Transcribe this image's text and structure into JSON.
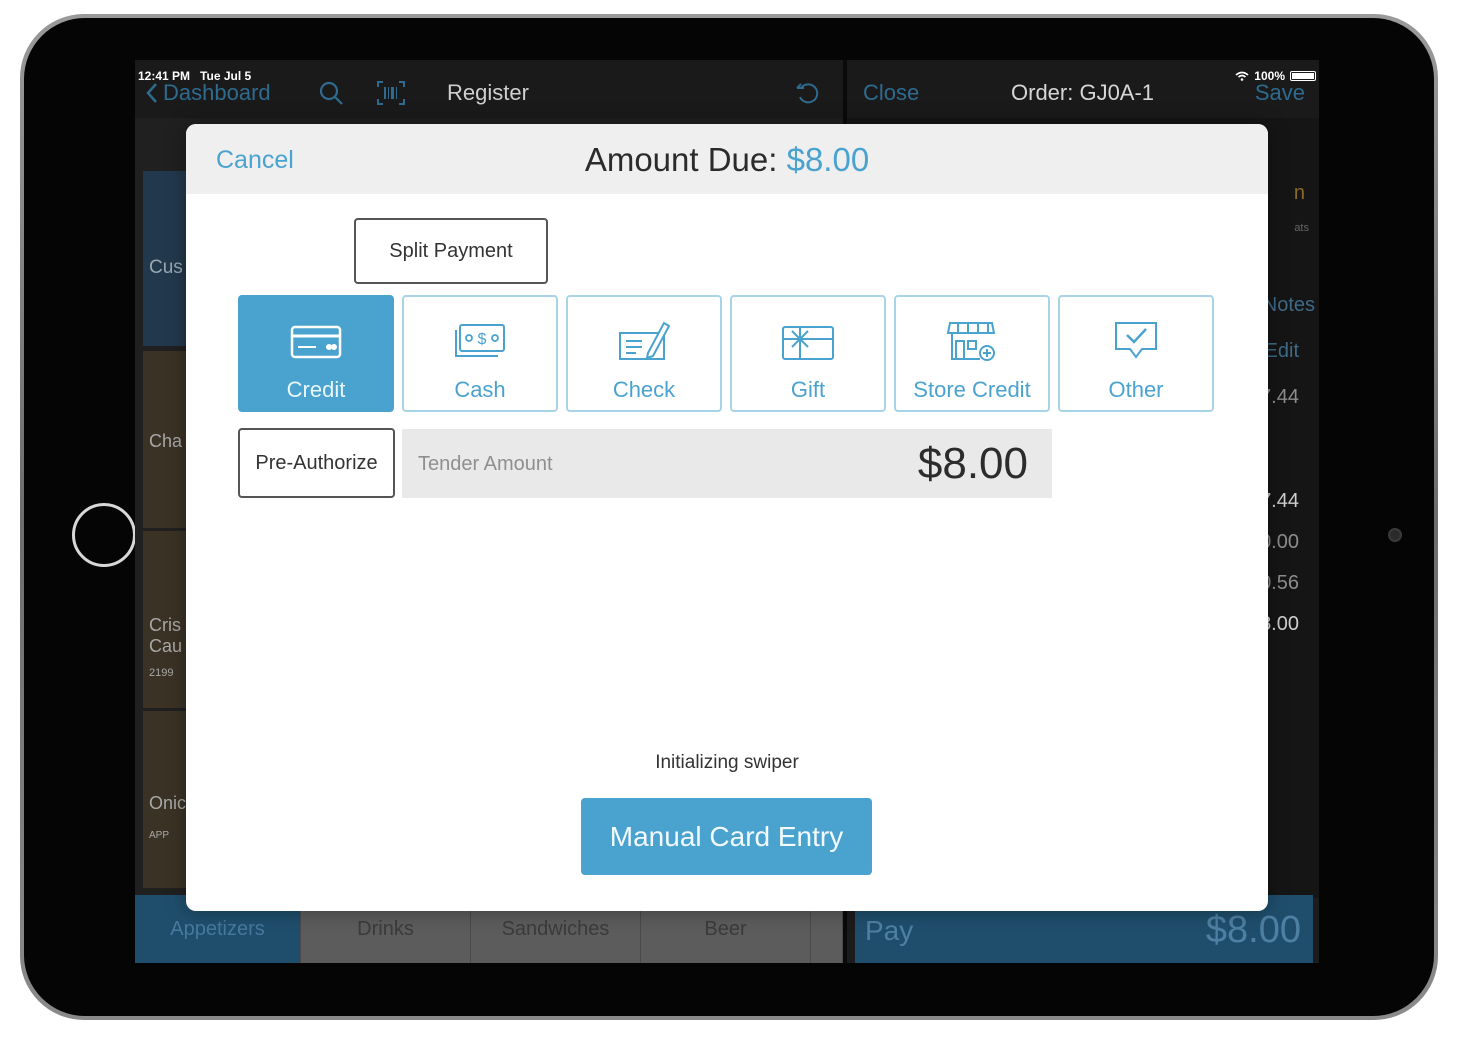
{
  "status_bar": {
    "time": "12:41 PM",
    "date": "Tue Jul 5",
    "battery": "100%"
  },
  "nav": {
    "back_label": "Dashboard",
    "title": "Register",
    "close_label": "Close",
    "order_label": "Order: GJ0A-1",
    "save_label": "Save"
  },
  "background": {
    "customer_label": "Cus",
    "tiles": [
      {
        "label": "Cha"
      },
      {
        "label": "Cris Cau",
        "code": "2199"
      },
      {
        "label": "Onic",
        "code": "APP"
      }
    ],
    "right_panel": {
      "dropdown_label": "n",
      "hint": "ats",
      "notes_label": "Notes",
      "edit_label": "Edit",
      "line_amount": "$7.44",
      "subtotal": "7.44",
      "discount": "0.00",
      "tax": "0.56",
      "total": "8.00"
    }
  },
  "tabs": [
    {
      "label": "Appetizers",
      "active": true
    },
    {
      "label": "Drinks",
      "active": false
    },
    {
      "label": "Sandwiches",
      "active": false
    },
    {
      "label": "Beer",
      "active": false
    }
  ],
  "pay_bar": {
    "label": "Pay",
    "amount": "$8.00"
  },
  "modal": {
    "cancel_label": "Cancel",
    "title_prefix": "Amount Due: ",
    "amount_due": "$8.00",
    "split_payment_label": "Split Payment",
    "tenders": [
      {
        "label": "Credit",
        "icon": "credit-card-icon",
        "selected": true
      },
      {
        "label": "Cash",
        "icon": "cash-icon",
        "selected": false
      },
      {
        "label": "Check",
        "icon": "check-icon",
        "selected": false
      },
      {
        "label": "Gift",
        "icon": "gift-card-icon",
        "selected": false
      },
      {
        "label": "Store Credit",
        "icon": "store-credit-icon",
        "selected": false
      },
      {
        "label": "Other",
        "icon": "other-tender-icon",
        "selected": false
      }
    ],
    "preauthorize_label": "Pre-Authorize",
    "tender_amount_label": "Tender Amount",
    "tender_amount_value": "$8.00",
    "swiper_status": "Initializing swiper",
    "manual_entry_label": "Manual Card Entry"
  },
  "colors": {
    "accent": "#4aa3cf",
    "accent_light_border": "#a9d3e7",
    "header_bg": "#efefef",
    "dark_nav_blue": "#1f4e6c"
  }
}
